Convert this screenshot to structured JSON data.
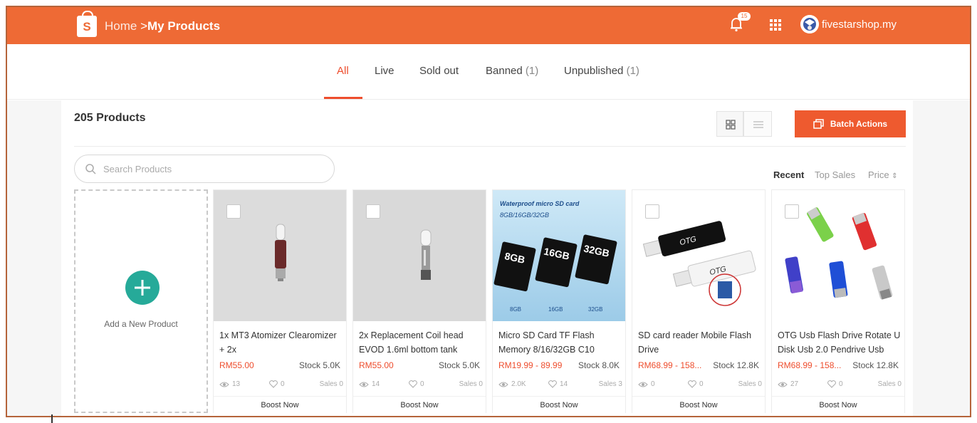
{
  "header": {
    "logo_letter": "S",
    "breadcrumb_home": "Home",
    "breadcrumb_sep": " >",
    "breadcrumb_current": "My Products",
    "notification_count": "15",
    "shop_name": "fivestarshop.my"
  },
  "tabs": [
    {
      "label": "All",
      "count": ""
    },
    {
      "label": "Live",
      "count": ""
    },
    {
      "label": "Sold out",
      "count": ""
    },
    {
      "label": "Banned",
      "count": "(1)"
    },
    {
      "label": "Unpublished",
      "count": "(1)"
    }
  ],
  "toolbar": {
    "product_count": "205 Products",
    "batch_actions_label": "Batch Actions",
    "search_placeholder": "Search Products",
    "sort_recent": "Recent",
    "sort_top_sales": "Top Sales",
    "sort_price": "Price",
    "sort_price_arrow": "⇕"
  },
  "add_product": {
    "label": "Add a New Product"
  },
  "products": [
    {
      "name": "1x MT3 Atomizer Clearomizer + 2x",
      "price": "RM55.00",
      "stock": "Stock 5.0K",
      "views": "13",
      "likes": "0",
      "sales": "Sales 0",
      "boost": "Boost Now"
    },
    {
      "name": "2x Replacement Coil head EVOD 1.6ml bottom tank",
      "price": "RM55.00",
      "stock": "Stock 5.0K",
      "views": "14",
      "likes": "0",
      "sales": "Sales 0",
      "boost": "Boost Now"
    },
    {
      "name": "Micro SD Card TF Flash Memory 8/16/32GB C10",
      "price": "RM19.99 - 89.99",
      "stock": "Stock 8.0K",
      "views": "2.0K",
      "likes": "14",
      "sales": "Sales 3",
      "boost": "Boost Now"
    },
    {
      "name": "SD card reader Mobile Flash Drive",
      "price": "RM68.99 - 158...",
      "stock": "Stock 12.8K",
      "views": "0",
      "likes": "0",
      "sales": "Sales 0",
      "boost": "Boost Now"
    },
    {
      "name": "OTG Usb Flash Drive Rotate U Disk Usb 2.0 Pendrive Usb",
      "price": "RM68.99 - 158...",
      "stock": "Stock 12.8K",
      "views": "27",
      "likes": "0",
      "sales": "Sales 0",
      "boost": "Boost Now"
    }
  ],
  "product_images": {
    "sd_card_banner": "Waterproof micro SD card",
    "sd_card_sizes_line": "8GB/16GB/32GB",
    "card_labels": [
      "8GB",
      "16GB",
      "32GB"
    ],
    "sd_reader_brand": "OTG"
  },
  "colors": {
    "brand": "#ee6a35",
    "accent": "#ee4d2d",
    "add_button": "#26aa99"
  },
  "icons": {
    "logo": "shopping-bag-icon",
    "notification": "bell-icon",
    "apps": "grid-apps-icon",
    "search": "search-icon",
    "views": "eye-icon",
    "likes": "heart-icon",
    "add": "plus-icon",
    "grid_view": "grid-view-icon",
    "list_view": "list-view-icon",
    "batch": "copy-icon"
  }
}
